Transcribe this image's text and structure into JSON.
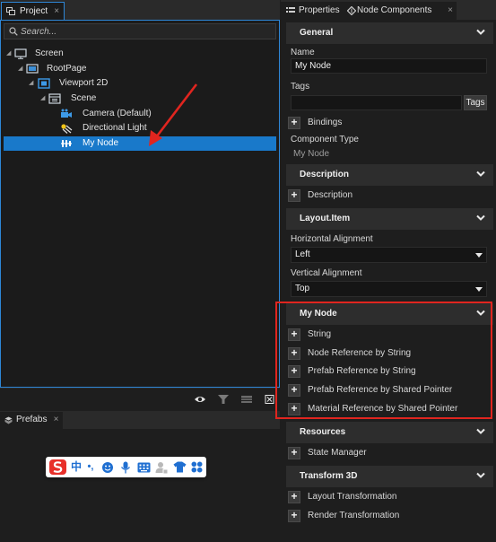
{
  "project": {
    "tab_label": "Project",
    "search_placeholder": "Search...",
    "tree": [
      {
        "label": "Screen",
        "icon": "monitor-icon"
      },
      {
        "label": "RootPage",
        "icon": "page-icon"
      },
      {
        "label": "Viewport 2D",
        "icon": "viewport-icon"
      },
      {
        "label": "Scene",
        "icon": "scene-icon"
      },
      {
        "label": "Camera (Default)",
        "icon": "camera-icon"
      },
      {
        "label": "Directional Light",
        "icon": "light-icon"
      },
      {
        "label": "My Node",
        "icon": "node-icon",
        "selected": true
      }
    ]
  },
  "prefabs": {
    "tab_label": "Prefabs"
  },
  "ime": {
    "chinese_char": "中",
    "punct": "•,"
  },
  "properties": {
    "tabs": [
      "Properties",
      "Node Components"
    ],
    "general": {
      "header": "General",
      "name_label": "Name",
      "name_value": "My Node",
      "tags_label": "Tags",
      "tags_value": "",
      "tags_button": "Tags",
      "bindings_label": "Bindings",
      "component_type_label": "Component Type",
      "component_type_value": "My Node"
    },
    "description": {
      "header": "Description",
      "add_label": "Description"
    },
    "layout_item": {
      "header": "Layout.Item",
      "h_align_label": "Horizontal Alignment",
      "h_align_value": "Left",
      "v_align_label": "Vertical Alignment",
      "v_align_value": "Top"
    },
    "my_node": {
      "header": "My Node",
      "items": [
        "String",
        "Node Reference by String",
        "Prefab Reference by String",
        "Prefab Reference by Shared Pointer",
        "Material Reference by Shared Pointer"
      ]
    },
    "resources": {
      "header": "Resources",
      "items": [
        "State Manager"
      ]
    },
    "transform_3d": {
      "header": "Transform 3D",
      "items": [
        "Layout Transformation",
        "Render Transformation"
      ]
    }
  },
  "colors": {
    "selection": "#1979ca",
    "highlight": "#e0251f",
    "accent_border": "#2e86d6"
  }
}
